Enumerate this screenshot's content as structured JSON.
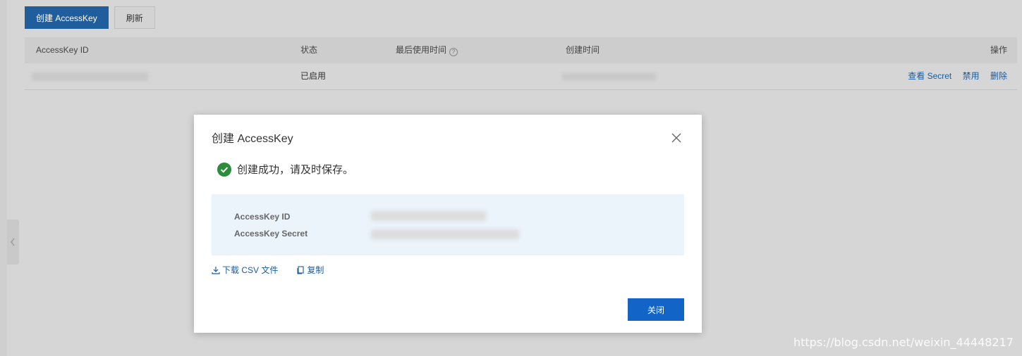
{
  "toolbar": {
    "create_label": "创建 AccessKey",
    "refresh_label": "刷新"
  },
  "table": {
    "headers": {
      "id": "AccessKey ID",
      "status": "状态",
      "last_used": "最后使用时间",
      "created": "创建时间",
      "ops": "操作"
    },
    "rows": [
      {
        "status": "已启用",
        "ops": [
          "查看 Secret",
          "禁用",
          "删除"
        ]
      }
    ]
  },
  "modal": {
    "title": "创建 AccessKey",
    "success_text": "创建成功，请及时保存。",
    "fields": {
      "id_label": "AccessKey ID",
      "secret_label": "AccessKey Secret"
    },
    "download_label": "下载 CSV 文件",
    "copy_label": "复制",
    "close_label": "关闭"
  },
  "colors": {
    "primary": "#1264c6",
    "link": "#1a5c9e",
    "success": "#2e8b3e",
    "box": "#ebf3fb"
  },
  "watermark": "https://blog.csdn.net/weixin_44448217"
}
